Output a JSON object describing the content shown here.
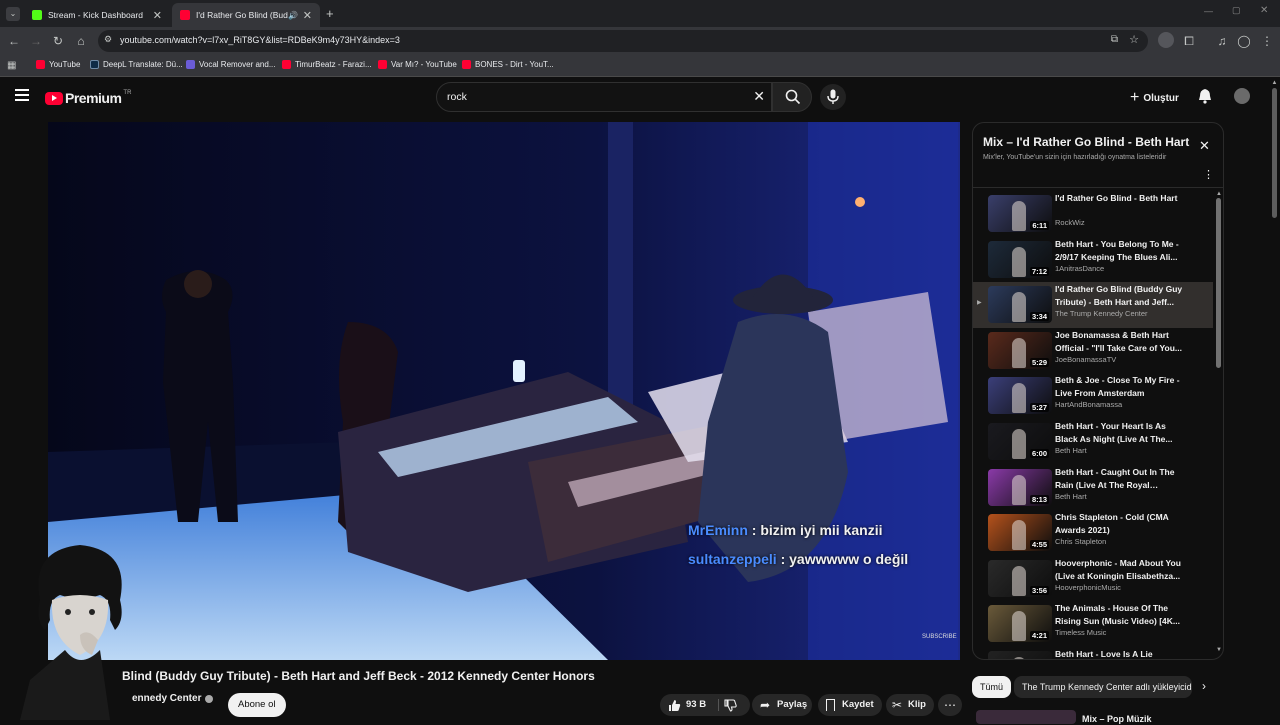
{
  "browser": {
    "tabs": [
      {
        "title": "Stream - Kick Dashboard",
        "favicon_color": "#53fc18",
        "active": false
      },
      {
        "title": "I'd Rather Go Blind (Buddy G",
        "favicon_color": "#ff0033",
        "active": true
      }
    ],
    "url": "youtube.com/watch?v=l7xv_RiT8GY&list=RDBeK9m4y73HY&index=3",
    "bookmarks": [
      {
        "label": "YouTube",
        "color": "#ff0033"
      },
      {
        "label": "DeepL Translate: Dü...",
        "color": "#0f2b46"
      },
      {
        "label": "Vocal Remover and...",
        "color": "#6b5cd6"
      },
      {
        "label": "TimurBeatz - Farazi...",
        "color": "#ff0033"
      },
      {
        "label": "Var Mı? - YouTube",
        "color": "#ff0033"
      },
      {
        "label": "BONES - Dirt - YouT...",
        "color": "#ff0033"
      }
    ]
  },
  "header": {
    "logo_text": "Premium",
    "logo_suffix": "TR",
    "search_value": "rock",
    "create_label": "Oluştur"
  },
  "player": {
    "chat": [
      {
        "user": "MrEminn",
        "message": ": bizim iyi mii kanzii"
      },
      {
        "user": "sultanzeppeli",
        "message": ": yawwwww o değil"
      }
    ],
    "watermark": "SUBSCRIBE"
  },
  "video": {
    "title": "Blind (Buddy Guy Tribute) - Beth Hart and Jeff Beck - 2012 Kennedy Center Honors",
    "channel": "ennedy Center",
    "subscribe_label": "Abone ol",
    "likes": "93 B",
    "share_label": "Paylaş",
    "save_label": "Kaydet",
    "clip_label": "Klip"
  },
  "playlist": {
    "title": "Mix – I'd Rather Go Blind - Beth Hart",
    "subtitle": "Mix'ler, YouTube'un sizin için hazırladığı oynatma listeleridir",
    "items": [
      {
        "title": "I'd Rather Go Blind - Beth Hart",
        "channel": "RockWiz",
        "duration": "6:11",
        "color": "#3a3f6b"
      },
      {
        "title": "Beth Hart - You Belong To Me - 2/9/17 Keeping The Blues Ali...",
        "channel": "1AnitrasDance",
        "duration": "7:12",
        "color": "#1d2a3a"
      },
      {
        "title": "I'd Rather Go Blind (Buddy Guy Tribute) - Beth Hart and Jeff...",
        "channel": "The Trump Kennedy Center",
        "duration": "3:34",
        "color": "#2c3b5c",
        "playing": true
      },
      {
        "title": "Joe Bonamassa & Beth Hart Official - \"I'll Take Care of You...",
        "channel": "JoeBonamassaTV",
        "duration": "5:29",
        "color": "#5a2a1c"
      },
      {
        "title": "Beth & Joe - Close To My Fire - Live From Amsterdam",
        "channel": "HartAndBonamassa",
        "duration": "5:27",
        "color": "#3b3f7a"
      },
      {
        "title": "Beth Hart - Your Heart Is As Black As Night (Live At The...",
        "channel": "Beth Hart",
        "duration": "6:00",
        "color": "#1a1a1f"
      },
      {
        "title": "Beth Hart - Caught Out In The Rain (Live At The Royal Albert...",
        "channel": "Beth Hart",
        "duration": "8:13",
        "color": "#8a3aa8"
      },
      {
        "title": "Chris Stapleton - Cold (CMA Awards 2021)",
        "channel": "Chris Stapleton",
        "duration": "4:55",
        "color": "#b5521c"
      },
      {
        "title": "Hooverphonic - Mad About You (Live at Koningin Elisabethza...",
        "channel": "HooverphonicMusic",
        "duration": "3:56",
        "color": "#2a2a2a"
      },
      {
        "title": "The Animals - House Of The Rising Sun (Music Video) [4K...",
        "channel": "Timeless Music",
        "duration": "4:21",
        "color": "#6a5a3a"
      },
      {
        "title": "Beth Hart - Love Is A Lie",
        "channel": "",
        "duration": "",
        "color": "#222"
      }
    ]
  },
  "chips": {
    "all": "Tümü",
    "uploader": "The Trump Kennedy Center adlı yükleyicide"
  },
  "next_item_title": "Mix – Pop Müzik"
}
